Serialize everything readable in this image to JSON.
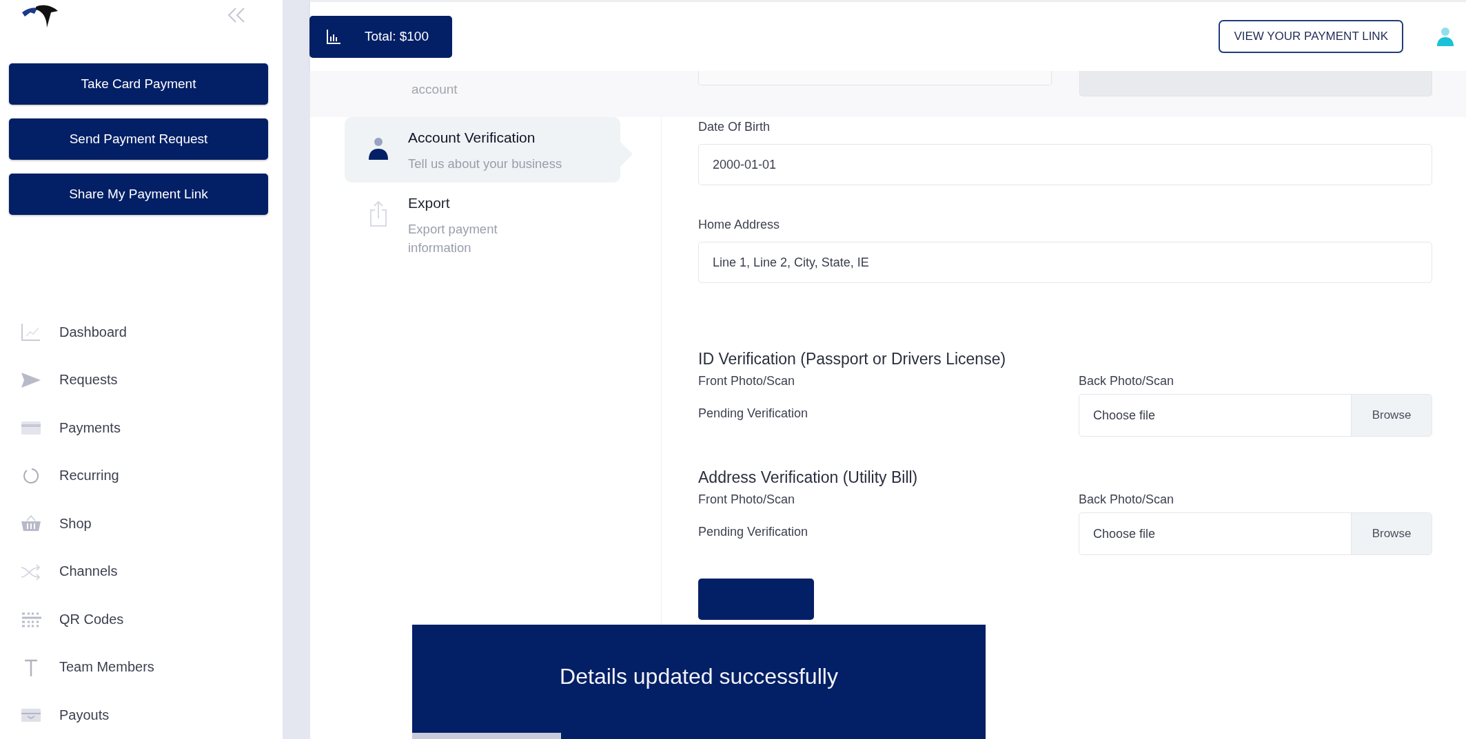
{
  "sidebar": {
    "actions": [
      "Take Card Payment",
      "Send Payment Request",
      "Share My Payment Link"
    ],
    "nav": [
      {
        "label": "Dashboard"
      },
      {
        "label": "Requests"
      },
      {
        "label": "Payments"
      },
      {
        "label": "Recurring"
      },
      {
        "label": "Shop"
      },
      {
        "label": "Channels"
      },
      {
        "label": "QR Codes"
      },
      {
        "label": "Team Members"
      },
      {
        "label": "Payouts"
      }
    ]
  },
  "header": {
    "total": "Total: $100",
    "link_button": "VIEW YOUR PAYMENT LINK"
  },
  "steps": [
    {
      "kind": "partial",
      "description": "account"
    },
    {
      "kind": "step",
      "title": "Account Verification",
      "description": "Tell us about your business",
      "selected": true
    },
    {
      "kind": "step",
      "title": "Export",
      "description": "Export payment information",
      "selected": false
    }
  ],
  "form": {
    "fields": [
      {
        "label": "Date Of Birth",
        "value": "2000-01-01"
      },
      {
        "label": "Home Address",
        "value": "Line 1, Line 2, City, State, IE"
      }
    ],
    "sections": [
      {
        "heading": "ID Verification (Passport or Drivers License)",
        "front_label": "Front Photo/Scan",
        "status": "Pending Verification",
        "back_label": "Back Photo/Scan",
        "file_placeholder": "Choose file",
        "browse": "Browse"
      },
      {
        "heading": "Address Verification (Utility Bill)",
        "front_label": "Front Photo/Scan",
        "status": "Pending Verification",
        "back_label": "Back Photo/Scan",
        "file_placeholder": "Choose file",
        "browse": "Browse"
      }
    ]
  },
  "toast": {
    "message": "Details updated successfully",
    "level": 0.26
  }
}
